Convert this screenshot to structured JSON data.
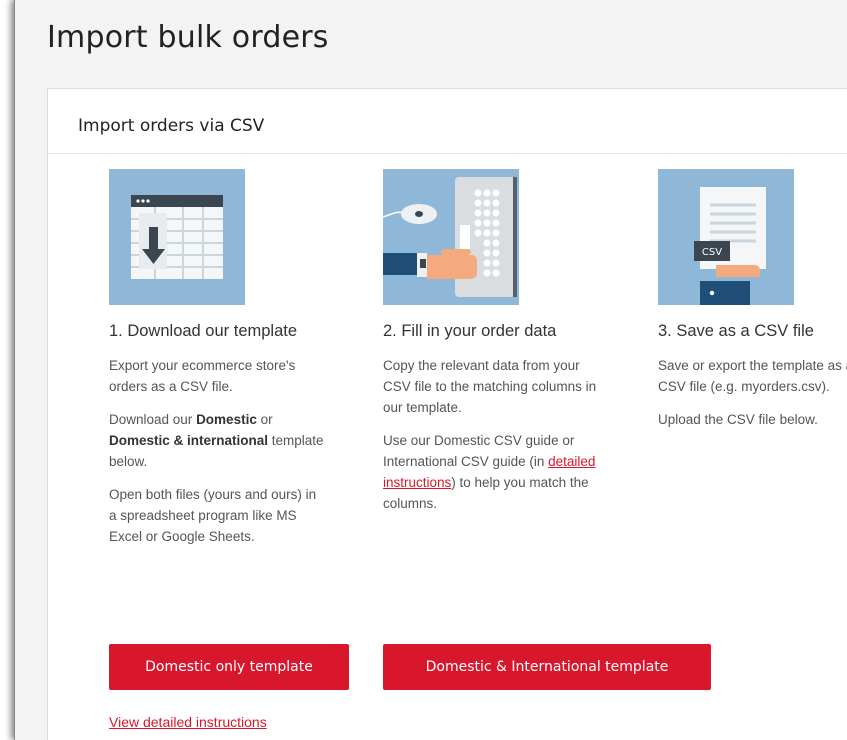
{
  "page": {
    "title": "Import bulk orders"
  },
  "card": {
    "title": "Import orders via CSV"
  },
  "steps": [
    {
      "heading": "1. Download our template",
      "paragraphs": [
        "Export your ecommerce store's orders as a CSV file.",
        {
          "pre": "Download our ",
          "bold1": "Domestic",
          "mid": " or ",
          "bold2": "Domestic & international",
          "post": " template below."
        },
        "Open both files (yours and ours) in a spreadsheet program like MS Excel or Google Sheets."
      ]
    },
    {
      "heading": "2. Fill in your order data",
      "paragraphs": [
        "Copy the relevant data from your CSV file to the matching columns in our template.",
        {
          "pre": "Use our Domestic CSV guide or International CSV guide (in ",
          "link": "detailed instructions",
          "post": ") to help you match the columns."
        }
      ]
    },
    {
      "heading": "3. Save as a CSV file",
      "paragraphs": [
        "Save or export the template as a CSV file (e.g. myorders.csv).",
        "Upload the CSV file below."
      ],
      "badge": "CSV"
    }
  ],
  "buttons": {
    "domestic_label": "Domestic only template",
    "international_label": "Domestic & International template"
  },
  "links": {
    "view_instructions": "View detailed instructions"
  },
  "colors": {
    "accent": "#d8172d",
    "illustration_bg": "#8fb8d8",
    "page_bg": "#f3f3f3"
  }
}
